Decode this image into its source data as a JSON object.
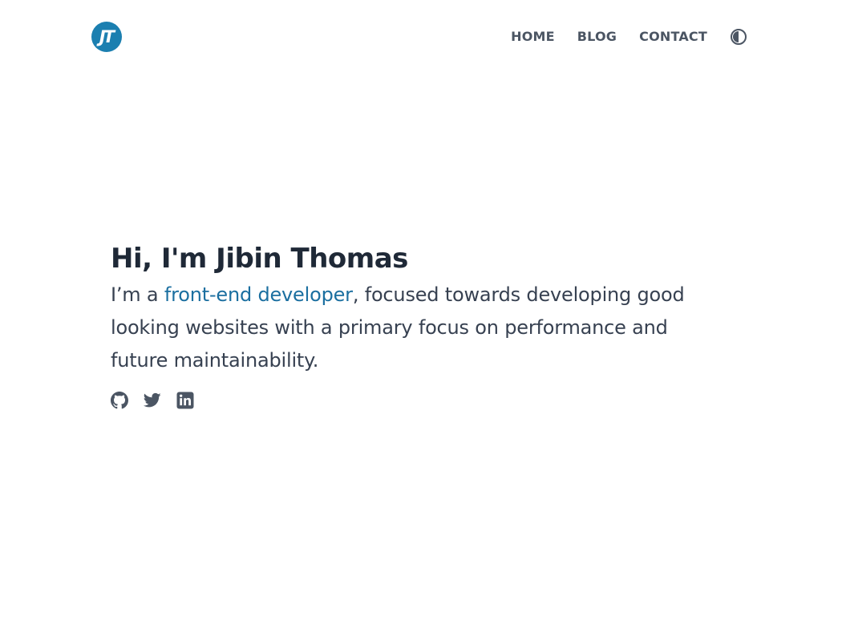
{
  "header": {
    "logo_text": "JT",
    "logo_color": "#1b7fb0",
    "nav": [
      {
        "label": "HOME"
      },
      {
        "label": "BLOG"
      },
      {
        "label": "CONTACT"
      }
    ],
    "theme_toggle_icon": "contrast-icon"
  },
  "hero": {
    "title": "Hi, I'm Jibin Thomas",
    "intro_prefix": "I’m a ",
    "intro_link": "front-end developer",
    "intro_suffix": ", focused towards developing good looking websites with a primary focus on performance and future maintainability.",
    "link_color": "#1b6fa0"
  },
  "socials": [
    {
      "icon": "github-icon"
    },
    {
      "icon": "twitter-icon"
    },
    {
      "icon": "linkedin-icon"
    }
  ]
}
